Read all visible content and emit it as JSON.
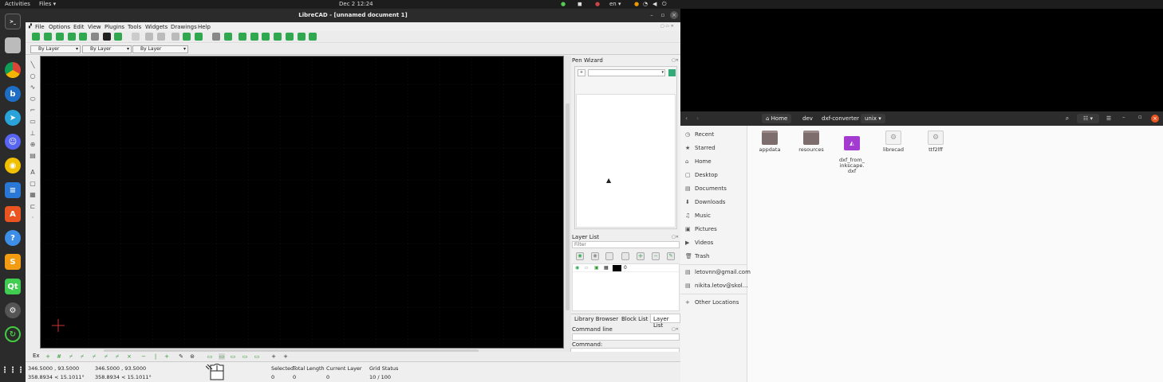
{
  "topbar": {
    "activities": "Activities",
    "app_menu": "Files ▾",
    "clock": "Dec 2  12:24",
    "lang": "en ▾"
  },
  "librecad": {
    "title": "LibreCAD - [unnamed document 1]",
    "menu": [
      "File",
      "Options",
      "Edit",
      "View",
      "Plugins",
      "Tools",
      "Widgets",
      "Drawings",
      "Help"
    ],
    "pen": {
      "color": "By Layer",
      "width": "By Layer",
      "type": "By Layer"
    },
    "pen_wizard": {
      "title": "Pen Wizard"
    },
    "layer_list": {
      "title": "Layer List",
      "filter_placeholder": "Filter",
      "layer_name": "0"
    },
    "tabs": [
      "Library Browser",
      "Block List",
      "Layer List"
    ],
    "command_line": {
      "title": "Command line",
      "label": "Command:"
    },
    "bottom_label": "Ex",
    "status": {
      "coord1_abs": "346.5000 , 93.5000",
      "coord1_rel": "358.8934 < 15.1011°",
      "coord2_abs": "346.5000 , 93.5000",
      "coord2_rel": "358.8934 < 15.1011°",
      "selected_label": "Selected",
      "selected_value": "0",
      "total_length_label": "Total Length",
      "total_length_value": "0",
      "current_layer_label": "Current Layer",
      "current_layer_value": "0",
      "grid_status_label": "Grid Status",
      "grid_status_value": "10 / 100"
    }
  },
  "files": {
    "breadcrumb": [
      "Home",
      "dev",
      "dxf-converter",
      "unix"
    ],
    "sidebar": [
      "Recent",
      "Starred",
      "Home",
      "Desktop",
      "Documents",
      "Downloads",
      "Music",
      "Pictures",
      "Videos",
      "Trash",
      "letovnn@gmail.com",
      "nikita.letov@skol...",
      "Other Locations"
    ],
    "items": [
      {
        "name": "appdata",
        "kind": "folder"
      },
      {
        "name": "resources",
        "kind": "folder"
      },
      {
        "name": "dxf_from_\ninkscape.\ndxf",
        "kind": "dxf"
      },
      {
        "name": "librecad",
        "kind": "exec"
      },
      {
        "name": "ttf2lff",
        "kind": "exec"
      }
    ]
  },
  "colors": {
    "accent_green": "#2fa84f",
    "folder": "#7d6d6d",
    "dxf": "#a33bd1",
    "close": "#e95420"
  }
}
